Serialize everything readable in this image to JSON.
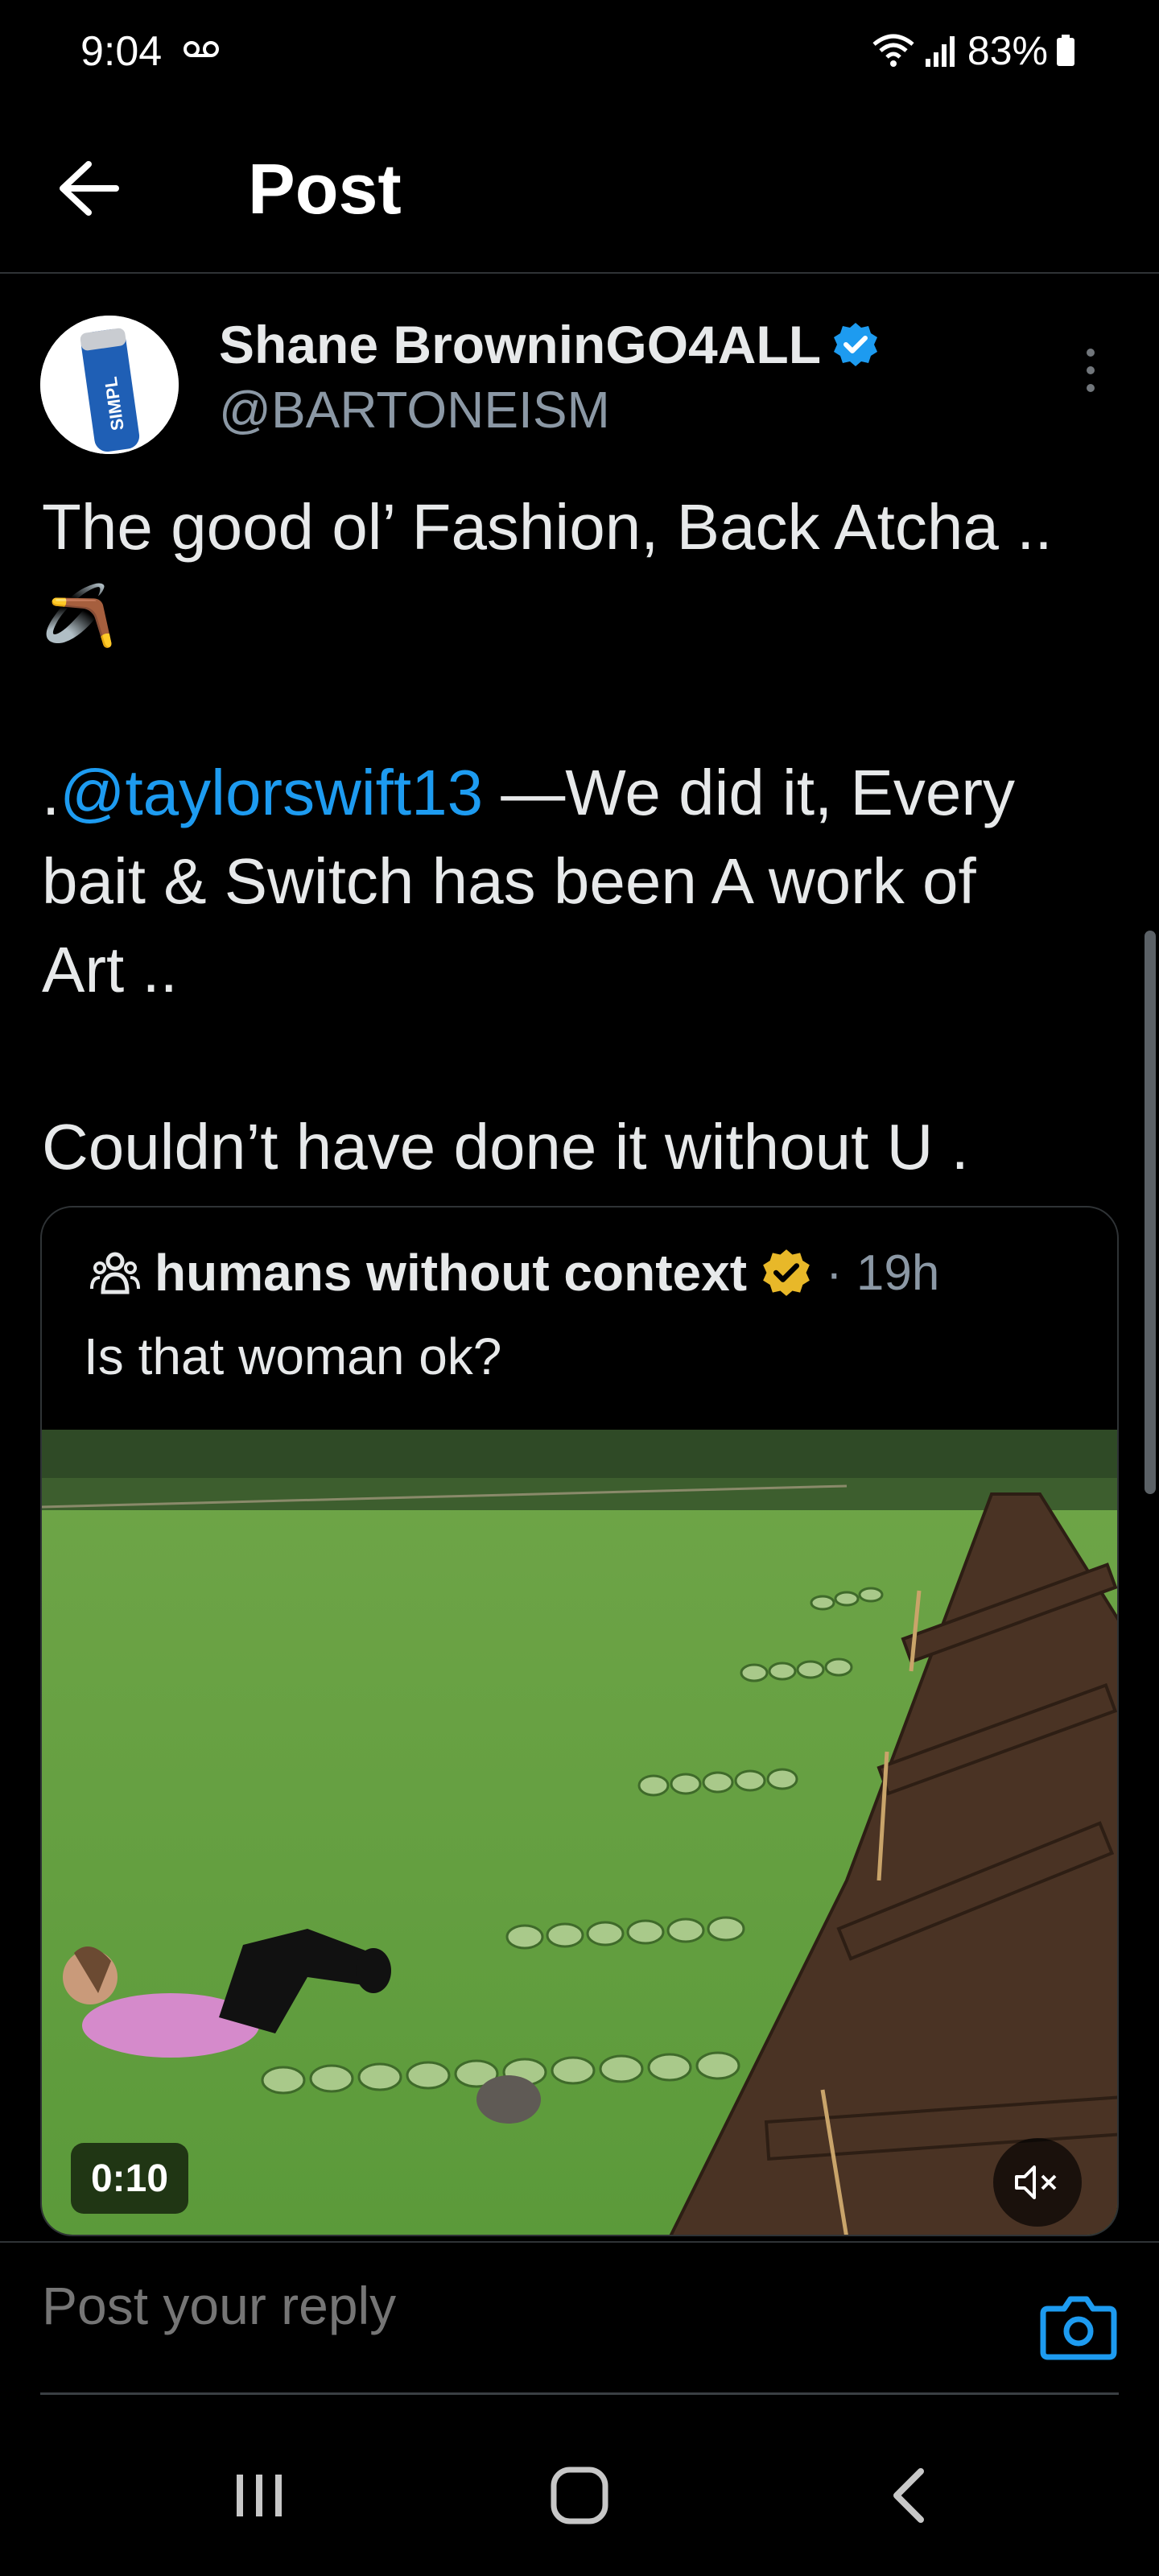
{
  "status_bar": {
    "time": "9:04",
    "battery": "83%",
    "icons": [
      "voicemail-icon",
      "wifi-icon",
      "signal-icon",
      "battery-icon"
    ]
  },
  "header": {
    "title": "Post",
    "back_icon": "arrow-left-icon"
  },
  "post": {
    "author_name": "Shane BrowninGO4ALL",
    "author_handle": "@BARTONEISM",
    "verified_badge_color": "#1d9bf0",
    "line1": "The good ol’ Fashion, Back Atcha ..",
    "line2": "🪃",
    "mention_prefix": ".",
    "mention": "@taylorswift13",
    "line3_rest": " —We did it, Every",
    "line4": "bait & Switch has been A work of",
    "line5": "Art ..",
    "line6": "Couldn’t have done it without U ."
  },
  "quote": {
    "name": "humans without context",
    "gold_badge_color": "#e8b829",
    "time": "· 19h",
    "text": "Is that woman ok?",
    "video_duration": "0:10"
  },
  "reply": {
    "placeholder": "Post your reply"
  },
  "colors": {
    "accent": "#1d9bf0",
    "background": "#000000",
    "text": "#e7e9ea",
    "muted": "#8b98a5"
  }
}
